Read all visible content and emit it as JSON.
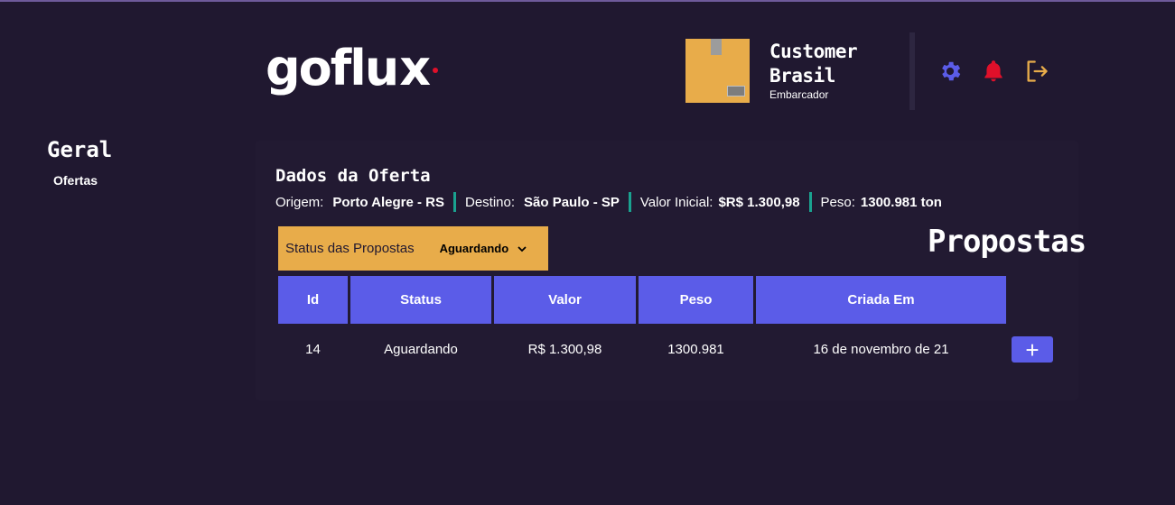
{
  "header": {
    "logo": {
      "text_main": "goflu",
      "text_x": "x"
    },
    "user": {
      "name": "Customer Brasil",
      "role": "Embarcador"
    },
    "icons": {
      "settings": "gear-icon",
      "notifications": "bell-icon",
      "logout": "logout-icon"
    }
  },
  "sidebar": {
    "title": "Geral",
    "items": [
      {
        "label": "Ofertas"
      }
    ]
  },
  "offer": {
    "title": "Dados da Oferta",
    "fields": [
      {
        "label": "Origem:",
        "value": "Porto Alegre - RS"
      },
      {
        "label": "Destino:",
        "value": "São Paulo - SP"
      },
      {
        "label": "Valor Inicial:",
        "value": "$R$ 1.300,98"
      },
      {
        "label": "Peso:",
        "value": "1300.981 ton"
      }
    ]
  },
  "proposals": {
    "title": "Propostas",
    "filter": {
      "label": "Status das Propostas",
      "selected": "Aguardando"
    },
    "columns": [
      "Id",
      "Status",
      "Valor",
      "Peso",
      "Criada Em"
    ],
    "rows": [
      {
        "id": "14",
        "status": "Aguardando",
        "valor": "R$ 1.300,98",
        "peso": "1300.981",
        "criada_em": "16 de novembro de 21"
      }
    ],
    "add_button": "+"
  },
  "colors": {
    "background": "#201830",
    "accent": "#5b5ce8",
    "orange": "#e8ac4a",
    "red": "#e0102a",
    "teal": "#1aa290"
  }
}
